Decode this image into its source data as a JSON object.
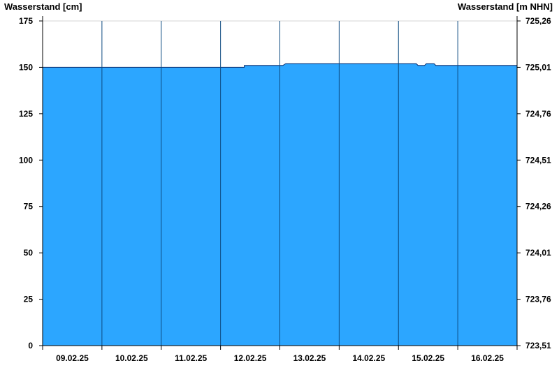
{
  "chart_data": {
    "type": "area",
    "ylabel_left": "Wasserstand [cm]",
    "ylabel_right": "Wasserstand [m NHN]",
    "y_ticks_left": [
      "0",
      "25",
      "50",
      "75",
      "100",
      "125",
      "150",
      "175"
    ],
    "y_ticks_right": [
      "723,51",
      "723,76",
      "724,01",
      "724,26",
      "724,51",
      "724,76",
      "725,01",
      "725,26"
    ],
    "ylim": [
      0,
      175
    ],
    "xlim_days": [
      0,
      8
    ],
    "x_tick_labels": [
      "09.02.25",
      "10.02.25",
      "11.02.25",
      "12.02.25",
      "13.02.25",
      "14.02.25",
      "15.02.25",
      "16.02.25"
    ],
    "grid": "vertical day lines",
    "series": [
      {
        "x_days": [
          0,
          3.4,
          3.4,
          4.05,
          4.1,
          6.3,
          6.33,
          6.44,
          6.47,
          6.6,
          6.63,
          8
        ],
        "values": [
          150,
          150,
          151,
          151,
          152,
          152,
          151,
          151,
          152,
          152,
          151,
          151
        ]
      }
    ],
    "colors": {
      "fill": "#2ca6ff",
      "line": "#0a2d6e",
      "grid": "#0c4a80",
      "top_grid": "#d6d6d6",
      "axis": "#000000"
    }
  }
}
